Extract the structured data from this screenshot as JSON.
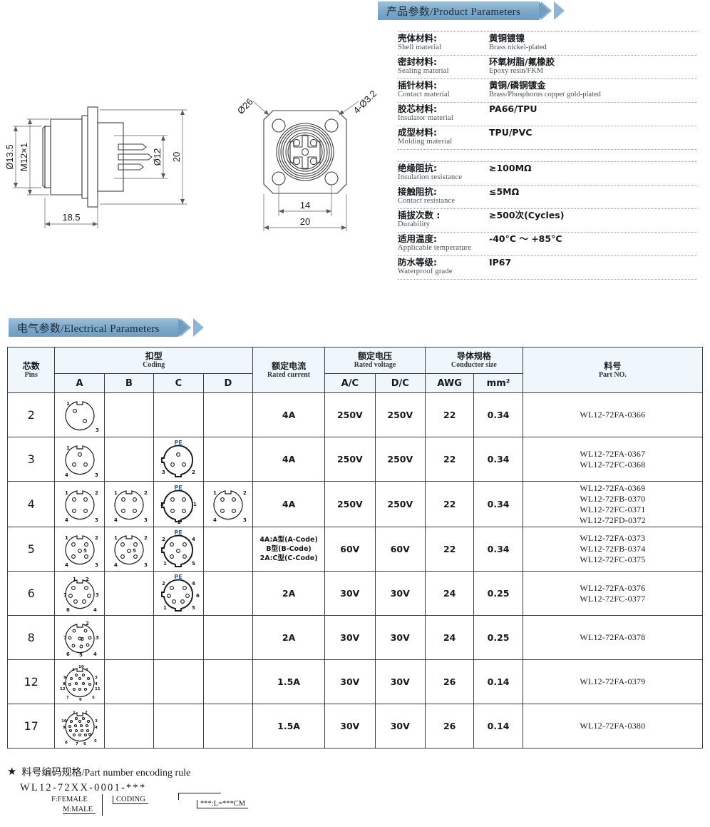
{
  "banners": {
    "product": "产品参数/Product Parameters",
    "electrical": "电气参数/Electrical Parameters"
  },
  "product_parameters": {
    "materials": [
      {
        "label_cn": "壳体材料:",
        "label_en": "Shell material",
        "value_cn": "黄铜镀镍",
        "value_en": "Brass nickel-plated"
      },
      {
        "label_cn": "密封材料:",
        "label_en": "Sealing material",
        "value_cn": "环氧树脂/氟橡胶",
        "value_en": "Epoxy resin/FKM"
      },
      {
        "label_cn": "插针材料:",
        "label_en": "Contact material",
        "value_cn": "黄铜/磷铜镀金",
        "value_en": "Brass/Phosphorus copper gold-plated"
      },
      {
        "label_cn": "胶芯材料:",
        "label_en": "Insulator material",
        "value_cn": "PA66/TPU",
        "value_en": ""
      },
      {
        "label_cn": "成型材料:",
        "label_en": "Molding material",
        "value_cn": "TPU/PVC",
        "value_en": ""
      }
    ],
    "performance": [
      {
        "label_cn": "绝缘阻抗:",
        "label_en": "Insulation resistance",
        "value_cn": "≥100MΩ",
        "value_en": ""
      },
      {
        "label_cn": "接触阻抗:",
        "label_en": "Contact resistance",
        "value_cn": "≤5MΩ",
        "value_en": ""
      },
      {
        "label_cn": "插拔次数 :",
        "label_en": "Durability",
        "value_cn": "≥500次(Cycles)",
        "value_en": ""
      },
      {
        "label_cn": "适用温度:",
        "label_en": "Applicable temperature",
        "value_cn": "-40°C ～ +85°C",
        "value_en": ""
      },
      {
        "label_cn": "防水等级:",
        "label_en": "Waterproof grade",
        "value_cn": "IP67",
        "value_en": ""
      }
    ]
  },
  "drawings": {
    "side_view": {
      "dim_thread": "M12×1",
      "dim_diameter_outer": "Ø13.5",
      "dim_diameter_pin": "Ø12",
      "dim_height": "20",
      "dim_length": "18.5"
    },
    "front_view": {
      "dim_diagonal": "Ø26",
      "dim_holes": "4-Ø3.2",
      "dim_hole_spacing": "14",
      "dim_flange": "20"
    }
  },
  "table": {
    "headers": {
      "pins": {
        "cn": "芯数",
        "en": "Pins"
      },
      "coding": {
        "cn": "扣型",
        "en": "Coding"
      },
      "coding_cols": [
        "A",
        "B",
        "C",
        "D"
      ],
      "rated_current": {
        "cn": "额定电流",
        "en": "Rated current"
      },
      "rated_voltage": {
        "cn": "额定电压",
        "en": "Rated voltage"
      },
      "voltage_cols": [
        "A/C",
        "D/C"
      ],
      "conductor_size": {
        "cn": "导体规格",
        "en": "Conductor size"
      },
      "conductor_cols": [
        "AWG",
        "mm²"
      ],
      "part_no": {
        "cn": "料号",
        "en": "Part NO."
      }
    },
    "rows": [
      {
        "pins": "2",
        "coding": {
          "A": true,
          "B": false,
          "C": false,
          "D": false
        },
        "current": "4A",
        "current_multi": null,
        "voltage_ac": "250V",
        "voltage_dc": "250V",
        "awg": "22",
        "mm2": "0.34",
        "part_numbers": [
          "WL12-72FA-0366"
        ]
      },
      {
        "pins": "3",
        "coding": {
          "A": true,
          "B": false,
          "C": true,
          "D": false
        },
        "current": "4A",
        "current_multi": null,
        "voltage_ac": "250V",
        "voltage_dc": "250V",
        "awg": "22",
        "mm2": "0.34",
        "part_numbers": [
          "WL12-72FA-0367",
          "WL12-72FC-0368"
        ]
      },
      {
        "pins": "4",
        "coding": {
          "A": true,
          "B": true,
          "C": true,
          "D": true
        },
        "current": "4A",
        "current_multi": null,
        "voltage_ac": "250V",
        "voltage_dc": "250V",
        "awg": "22",
        "mm2": "0.34",
        "part_numbers": [
          "WL12-72FA-0369",
          "WL12-72FB-0370",
          "WL12-72FC-0371",
          "WL12-72FD-0372"
        ]
      },
      {
        "pins": "5",
        "coding": {
          "A": true,
          "B": true,
          "C": true,
          "D": false
        },
        "current": null,
        "current_multi": [
          "4A:A型(A-Code)",
          "B型(B-Code)",
          "2A:C型(C-Code)"
        ],
        "voltage_ac": "60V",
        "voltage_dc": "60V",
        "awg": "22",
        "mm2": "0.34",
        "part_numbers": [
          "WL12-72FA-0373",
          "WL12-72FB-0374",
          "WL12-72FC-0375"
        ]
      },
      {
        "pins": "6",
        "coding": {
          "A": true,
          "B": false,
          "C": true,
          "D": false
        },
        "current": "2A",
        "current_multi": null,
        "voltage_ac": "30V",
        "voltage_dc": "30V",
        "awg": "24",
        "mm2": "0.25",
        "part_numbers": [
          "WL12-72FA-0376",
          "WL12-72FC-0377"
        ]
      },
      {
        "pins": "8",
        "coding": {
          "A": true,
          "B": false,
          "C": false,
          "D": false
        },
        "current": "2A",
        "current_multi": null,
        "voltage_ac": "30V",
        "voltage_dc": "30V",
        "awg": "24",
        "mm2": "0.25",
        "part_numbers": [
          "WL12-72FA-0378"
        ]
      },
      {
        "pins": "12",
        "coding": {
          "A": true,
          "B": false,
          "C": false,
          "D": false
        },
        "current": "1.5A",
        "current_multi": null,
        "voltage_ac": "30V",
        "voltage_dc": "30V",
        "awg": "26",
        "mm2": "0.14",
        "part_numbers": [
          "WL12-72FA-0379"
        ]
      },
      {
        "pins": "17",
        "coding": {
          "A": true,
          "B": false,
          "C": false,
          "D": false
        },
        "current": "1.5A",
        "current_multi": null,
        "voltage_ac": "30V",
        "voltage_dc": "30V",
        "awg": "26",
        "mm2": "0.14",
        "part_numbers": [
          "WL12-72FA-0380"
        ]
      }
    ]
  },
  "footer": {
    "star": "★",
    "title": "料号编码规格/Part number encoding rule",
    "code": "WL12-72XX-0001-***",
    "note_gender_1": "F:FEMALE",
    "note_gender_2": "M:MALE",
    "note_coding": "CODING",
    "note_length": "***:L=***CM"
  },
  "colors": {
    "banner": "#7ba7c8",
    "header_fill": "#eff7fc",
    "line": "#3c3c3c",
    "pe_label": "#2b5fa8"
  }
}
